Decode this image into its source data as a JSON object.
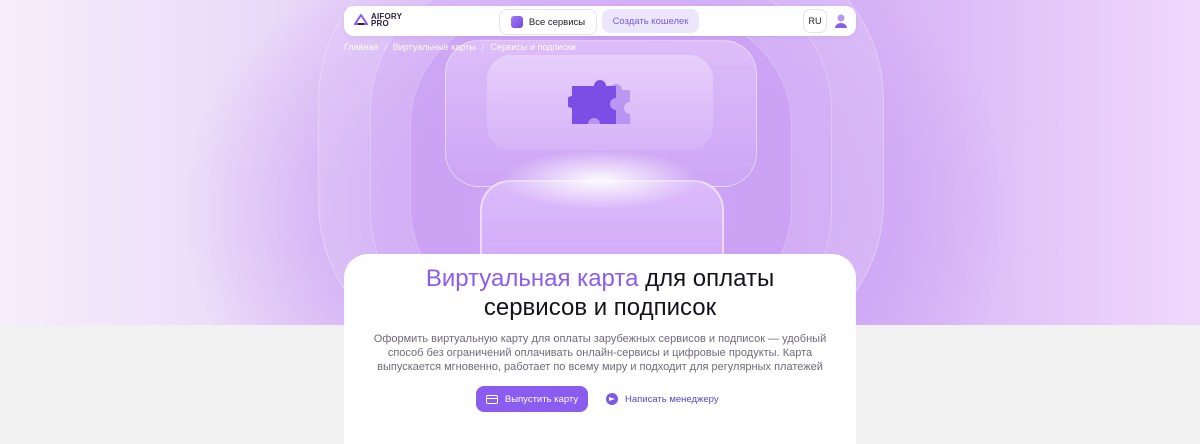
{
  "header": {
    "logo_line1": "AIFORY",
    "logo_line2": "PRO",
    "all_services_label": "Все сервисы",
    "create_wallet_label": "Создать кошелек",
    "language": "RU"
  },
  "breadcrumb": {
    "items": [
      "Главная",
      "Виртуальные карты",
      "Сервисы и подписки"
    ],
    "separator": "/"
  },
  "hero": {
    "title_accent": "Виртуальная карта",
    "title_rest_line1": " для оплаты",
    "title_line2": "сервисов и подписок",
    "description": "Оформить виртуальную карту для оплаты зарубежных сервисов и подписок — удобный способ без ограничений оплачивать онлайн-сервисы и цифровые продукты. Карта выпускается мгновенно, работает по всему миру и подходит для регулярных платежей",
    "primary_button_label": "Выпустить карту",
    "secondary_button_label": "Написать менеджеру"
  },
  "colors": {
    "accent": "#8b5cf0",
    "accent_light": "#ece6fb",
    "text_dark": "#15121c",
    "text_muted": "#6f6a7a"
  },
  "icons": {
    "logo": "aifory-logo-icon",
    "services": "grid-app-icon",
    "user": "user-icon",
    "puzzle": "puzzle-icon",
    "card": "credit-card-icon",
    "telegram": "telegram-icon"
  }
}
